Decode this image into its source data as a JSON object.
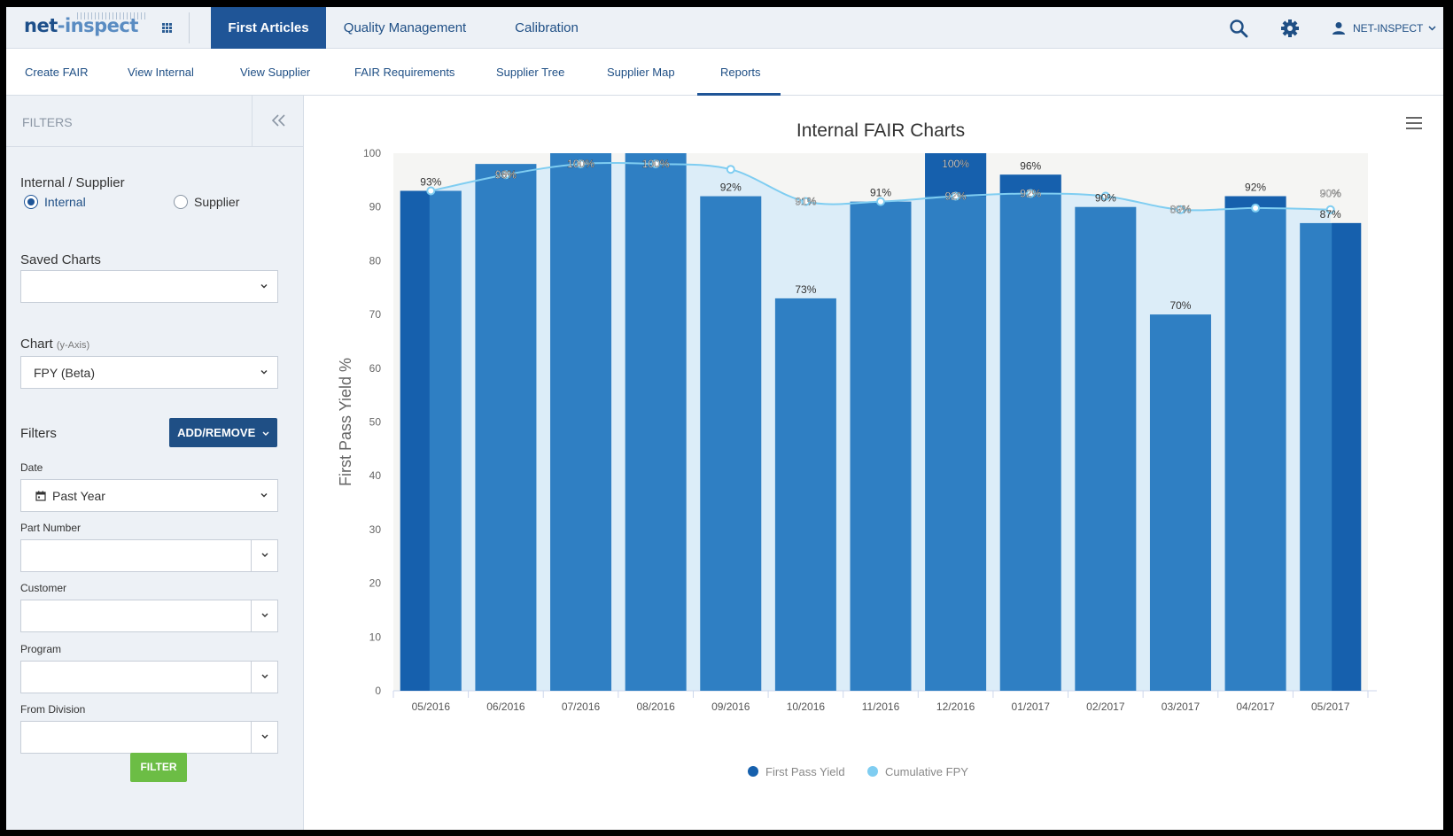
{
  "brand": {
    "logo_text_1": "net",
    "logo_text_2": "-inspect"
  },
  "top_tabs": [
    {
      "label": "First Articles",
      "active": true
    },
    {
      "label": "Quality Management",
      "active": false
    },
    {
      "label": "Calibration",
      "active": false
    }
  ],
  "user": {
    "name": "NET-INSPECT"
  },
  "sub_tabs": [
    {
      "label": "Create FAIR"
    },
    {
      "label": "View Internal"
    },
    {
      "label": "View Supplier"
    },
    {
      "label": "FAIR Requirements"
    },
    {
      "label": "Supplier Tree"
    },
    {
      "label": "Supplier Map"
    },
    {
      "label": "Reports",
      "active": true
    }
  ],
  "sidebar": {
    "title": "FILTERS",
    "internal_supplier_label": "Internal / Supplier",
    "radio_internal": "Internal",
    "radio_supplier": "Supplier",
    "selected_radio": "Internal",
    "saved_charts_label": "Saved Charts",
    "saved_charts_value": "",
    "chart_label": "Chart",
    "chart_label_hint": "(y-Axis)",
    "chart_value": "FPY (Beta)",
    "filters_label": "Filters",
    "add_remove": "ADD/REMOVE",
    "date_label": "Date",
    "date_value": "Past Year",
    "part_number_label": "Part Number",
    "customer_label": "Customer",
    "program_label": "Program",
    "from_division_label": "From Division",
    "filter_button": "FILTER"
  },
  "colors": {
    "bar": "#2f7fc3",
    "bar_dark": "#1660ad",
    "line": "#7fcdf1",
    "area": "#dcedf8",
    "plot_bg": "#f5f5f3"
  },
  "chart_data": {
    "type": "bar",
    "title": "Internal FAIR Charts",
    "ylabel": "First Pass Yield %",
    "ylim": [
      0,
      100
    ],
    "yticks": [
      0,
      10,
      20,
      30,
      40,
      50,
      60,
      70,
      80,
      90,
      100
    ],
    "categories": [
      "05/2016",
      "06/2016",
      "07/2016",
      "08/2016",
      "09/2016",
      "10/2016",
      "11/2016",
      "12/2016",
      "01/2017",
      "02/2017",
      "03/2017",
      "04/2017",
      "05/2017"
    ],
    "series": [
      {
        "name": "First Pass Yield",
        "type": "bar",
        "values": [
          93,
          98,
          100,
          100,
          92,
          73,
          91,
          100,
          96,
          90,
          70,
          92,
          87
        ],
        "labels": [
          "93%",
          "96%",
          "100%",
          "100%",
          "92%",
          "73%",
          "91%",
          "100%",
          "96%",
          "90%",
          "70%",
          "92%",
          "87%"
        ]
      },
      {
        "name": "Cumulative FPY",
        "type": "line",
        "values": [
          93,
          96,
          98,
          98,
          97,
          91,
          91,
          92,
          92.5,
          92,
          89.5,
          89.8,
          89.5
        ],
        "labels": [
          "",
          "98%",
          "100%",
          "100%",
          "",
          "91%",
          "",
          "92%",
          "92%",
          "",
          "89%",
          "",
          "90%"
        ]
      }
    ],
    "legend_position": "bottom-center"
  }
}
